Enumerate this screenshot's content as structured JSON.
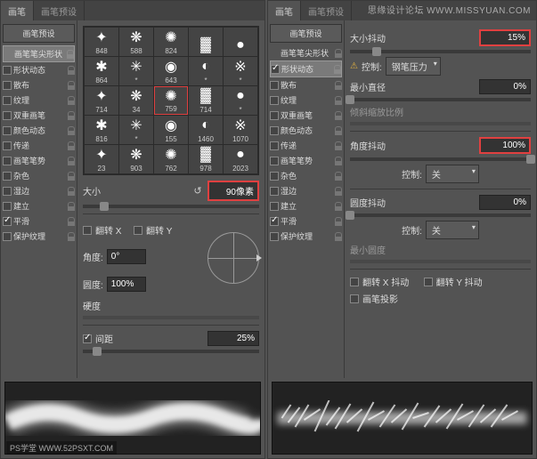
{
  "watermark": "思缘设计论坛  WWW.MISSYUAN.COM",
  "footer_mark": "PS学堂  WWW.52PSXT.COM",
  "tabs": {
    "a": "画笔",
    "b": "画笔预设"
  },
  "left": {
    "side_btn": "画笔预设",
    "items": [
      {
        "label": "画笔笔尖形状",
        "cb": null,
        "sel": true
      },
      {
        "label": "形状动态",
        "cb": false
      },
      {
        "label": "散布",
        "cb": false
      },
      {
        "label": "纹理",
        "cb": false
      },
      {
        "label": "双重画笔",
        "cb": false
      },
      {
        "label": "颜色动态",
        "cb": false
      },
      {
        "label": "传递",
        "cb": false
      },
      {
        "label": "画笔笔势",
        "cb": false
      },
      {
        "label": "杂色",
        "cb": false
      },
      {
        "label": "湿边",
        "cb": false
      },
      {
        "label": "建立",
        "cb": false
      },
      {
        "label": "平滑",
        "cb": true
      },
      {
        "label": "保护纹理",
        "cb": false
      }
    ],
    "brushes": [
      [
        "848",
        "588",
        "824"
      ],
      [
        "864",
        "*",
        "643",
        "*",
        "*"
      ],
      [
        "714",
        "34",
        "759",
        "714",
        "*"
      ],
      [
        "816",
        "*",
        "155",
        "1460",
        "1070"
      ],
      [
        "23",
        "903",
        "762",
        "978",
        "2023"
      ]
    ],
    "size_label": "大小",
    "size_value": "90",
    "size_unit": "像素",
    "flipx": "翻转 X",
    "flipy": "翻转 Y",
    "angle_label": "角度:",
    "angle_value": "0°",
    "round_label": "圆度:",
    "round_value": "100%",
    "hardness": "硬度",
    "spacing_label": "间距",
    "spacing_value": "25%"
  },
  "right": {
    "side_btn": "画笔预设",
    "items": [
      {
        "label": "画笔笔尖形状",
        "cb": null
      },
      {
        "label": "形状动态",
        "cb": true,
        "sel": true
      },
      {
        "label": "散布",
        "cb": false
      },
      {
        "label": "纹理",
        "cb": false
      },
      {
        "label": "双重画笔",
        "cb": false
      },
      {
        "label": "颜色动态",
        "cb": false
      },
      {
        "label": "传递",
        "cb": false
      },
      {
        "label": "画笔笔势",
        "cb": false
      },
      {
        "label": "杂色",
        "cb": false
      },
      {
        "label": "湿边",
        "cb": false
      },
      {
        "label": "建立",
        "cb": false
      },
      {
        "label": "平滑",
        "cb": true
      },
      {
        "label": "保护纹理",
        "cb": false
      }
    ],
    "size_jitter_label": "大小抖动",
    "size_jitter_value": "15%",
    "ctrl_label": "控制:",
    "ctrl_pen": "钢笔压力",
    "ctrl_icon": "⚠",
    "min_dia": "最小直径",
    "min_dia_value": "0%",
    "tilt_scale": "倾斜缩放比例",
    "angle_jitter_label": "角度抖动",
    "angle_jitter_value": "100%",
    "ctrl_off": "关",
    "round_jitter_label": "圆度抖动",
    "round_jitter_value": "0%",
    "min_round": "最小圆度",
    "flipx_j": "翻转 X 抖动",
    "flipy_j": "翻转 Y 抖动",
    "brush_proj": "画笔投影"
  }
}
